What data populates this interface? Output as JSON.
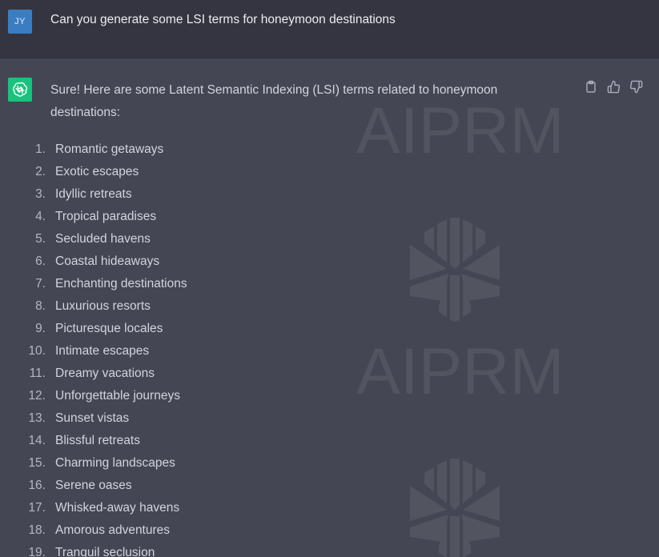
{
  "user_message": {
    "avatar_initials": "JY",
    "text": "Can you generate some LSI terms for honeymoon destinations"
  },
  "assistant_message": {
    "avatar_icon": "openai-logo-icon",
    "intro": "Sure! Here are some Latent Semantic Indexing (LSI) terms related to honeymoon destinations:",
    "items": [
      {
        "num": "1.",
        "text": "Romantic getaways"
      },
      {
        "num": "2.",
        "text": "Exotic escapes"
      },
      {
        "num": "3.",
        "text": "Idyllic retreats"
      },
      {
        "num": "4.",
        "text": "Tropical paradises"
      },
      {
        "num": "5.",
        "text": "Secluded havens"
      },
      {
        "num": "6.",
        "text": "Coastal hideaways"
      },
      {
        "num": "7.",
        "text": "Enchanting destinations"
      },
      {
        "num": "8.",
        "text": "Luxurious resorts"
      },
      {
        "num": "9.",
        "text": "Picturesque locales"
      },
      {
        "num": "10.",
        "text": "Intimate escapes"
      },
      {
        "num": "11.",
        "text": "Dreamy vacations"
      },
      {
        "num": "12.",
        "text": "Unforgettable journeys"
      },
      {
        "num": "13.",
        "text": "Sunset vistas"
      },
      {
        "num": "14.",
        "text": "Blissful retreats"
      },
      {
        "num": "15.",
        "text": "Charming landscapes"
      },
      {
        "num": "16.",
        "text": "Serene oases"
      },
      {
        "num": "17.",
        "text": "Whisked-away havens"
      },
      {
        "num": "18.",
        "text": "Amorous adventures"
      },
      {
        "num": "19.",
        "text": "Tranquil seclusion"
      }
    ],
    "actions": [
      {
        "name": "copy-button",
        "icon": "clipboard-icon"
      },
      {
        "name": "thumbs-up-button",
        "icon": "thumbs-up-icon"
      },
      {
        "name": "thumbs-down-button",
        "icon": "thumbs-down-icon"
      }
    ]
  },
  "watermark": {
    "text": "AIPRM",
    "logo_icon": "aiprm-logo-icon"
  },
  "colors": {
    "user_bg": "#343541",
    "assistant_bg": "#444654",
    "user_avatar": "#3a7ec1",
    "bot_avatar": "#19c37d",
    "text": "#d1d5db",
    "watermark": "#52545f"
  }
}
